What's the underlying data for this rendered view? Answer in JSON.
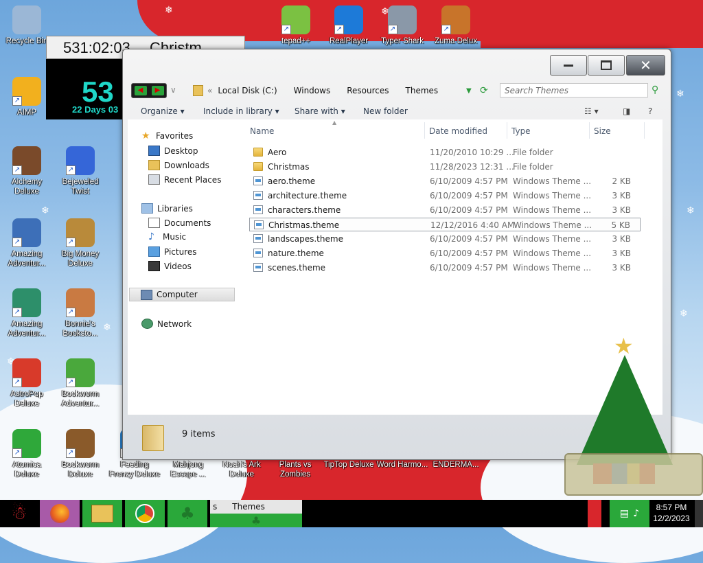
{
  "desktop": {
    "icons": [
      {
        "label": "Recycle Bin",
        "icon": "recycle-bin-icon",
        "color": "#9bb7d6"
      },
      {
        "label": "AIMP",
        "icon": "aimp-icon",
        "color": "#f2b01e"
      },
      {
        "label": "Alchemy Deluxe",
        "icon": "alchemy-icon",
        "color": "#7a4a2a"
      },
      {
        "label": "Bejeweled Twist",
        "icon": "bejeweled-icon",
        "color": "#3566d8"
      },
      {
        "label": "Amazing Adventur...",
        "icon": "amazing-adventures-icon",
        "color": "#3d6fb8"
      },
      {
        "label": "Big Money Deluxe",
        "icon": "big-money-icon",
        "color": "#b98a3a"
      },
      {
        "label": "Amazing Adventur...",
        "icon": "amazing-adventures-2-icon",
        "color": "#2d8f6a"
      },
      {
        "label": "Bonnie's Booksto...",
        "icon": "bonnies-bookstore-icon",
        "color": "#c97a42"
      },
      {
        "label": "AstroPop Deluxe",
        "icon": "astropop-icon",
        "color": "#d83a2a"
      },
      {
        "label": "Bookworm Adventur...",
        "icon": "bookworm-adventures-icon",
        "color": "#4aa83c"
      },
      {
        "label": "Atomica Deluxe",
        "icon": "atomica-icon",
        "color": "#2fa83a"
      },
      {
        "label": "Bookworm Deluxe",
        "icon": "bookworm-deluxe-icon",
        "color": "#8a5a2a"
      },
      {
        "label": "Feeding Frenzy Deluxe",
        "icon": "feeding-frenzy-icon",
        "color": "#2a7ec8"
      },
      {
        "label": "Mahjong Escape ...",
        "icon": "mahjong-icon",
        "color": "#2a8a4a"
      },
      {
        "label": "Noah's Ark Deluxe",
        "icon": "noahs-ark-icon",
        "color": "#c8742a"
      },
      {
        "label": "Plants vs Zombies",
        "icon": "plants-vs-zombies-icon",
        "color": "#5ab03a"
      },
      {
        "label": "TipTop Deluxe",
        "icon": "tiptop-icon",
        "color": "#d8a02a"
      },
      {
        "label": "Word Harmo...",
        "icon": "word-harmony-icon",
        "color": "#8a4ac8"
      },
      {
        "label": "ENDERMA...",
        "icon": "enderman-icon",
        "color": "#333333"
      },
      {
        "label": "tepad++",
        "icon": "notepad-plus-plus-icon",
        "color": "#7bc142"
      },
      {
        "label": "RealPlayer",
        "icon": "realplayer-icon",
        "color": "#1d7ad8"
      },
      {
        "label": "Typer Shark",
        "icon": "typer-shark-icon",
        "color": "#8a98a8"
      },
      {
        "label": "Zuma Delux",
        "icon": "zuma-icon",
        "color": "#c8742a"
      },
      {
        "label": "Deluxe",
        "icon": "generic-game-icon",
        "color": "#3a6ab8"
      }
    ]
  },
  "gadget": {
    "countdown": "531:02:03",
    "title": "Christm",
    "big": "53",
    "days": "22 Days 03"
  },
  "window": {
    "address": {
      "crumbs": [
        "Local Disk (C:)",
        "Windows",
        "Resources",
        "Themes"
      ]
    },
    "search": {
      "placeholder": "Search Themes"
    },
    "toolbar": {
      "organize": "Organize",
      "include": "Include in library",
      "share": "Share with",
      "new_folder": "New folder"
    },
    "nav": {
      "favorites": "Favorites",
      "desktop": "Desktop",
      "downloads": "Downloads",
      "recent": "Recent Places",
      "libraries": "Libraries",
      "documents": "Documents",
      "music": "Music",
      "pictures": "Pictures",
      "videos": "Videos",
      "computer": "Computer",
      "network": "Network"
    },
    "columns": {
      "name": "Name",
      "date": "Date modified",
      "type": "Type",
      "size": "Size"
    },
    "files": [
      {
        "name": "Aero",
        "date": "11/20/2010 10:29 ...",
        "type": "File folder",
        "size": "",
        "kind": "folder"
      },
      {
        "name": "Christmas",
        "date": "11/28/2023 12:31 ...",
        "type": "File folder",
        "size": "",
        "kind": "folder"
      },
      {
        "name": "aero.theme",
        "date": "6/10/2009 4:57 PM",
        "type": "Windows Theme ...",
        "size": "2 KB",
        "kind": "theme"
      },
      {
        "name": "architecture.theme",
        "date": "6/10/2009 4:57 PM",
        "type": "Windows Theme ...",
        "size": "3 KB",
        "kind": "theme"
      },
      {
        "name": "characters.theme",
        "date": "6/10/2009 4:57 PM",
        "type": "Windows Theme ...",
        "size": "3 KB",
        "kind": "theme"
      },
      {
        "name": "Christmas.theme",
        "date": "12/12/2016 4:40 AM",
        "type": "Windows Theme ...",
        "size": "5 KB",
        "kind": "theme"
      },
      {
        "name": "landscapes.theme",
        "date": "6/10/2009 4:57 PM",
        "type": "Windows Theme ...",
        "size": "3 KB",
        "kind": "theme"
      },
      {
        "name": "nature.theme",
        "date": "6/10/2009 4:57 PM",
        "type": "Windows Theme ...",
        "size": "3 KB",
        "kind": "theme"
      },
      {
        "name": "scenes.theme",
        "date": "6/10/2009 4:57 PM",
        "type": "Windows Theme ...",
        "size": "3 KB",
        "kind": "theme"
      }
    ],
    "status": {
      "count": "9 items"
    }
  },
  "taskbar": {
    "active_label": "Themes",
    "active_prefix": "s",
    "time": "8:57 PM",
    "date": "12/2/2023"
  }
}
